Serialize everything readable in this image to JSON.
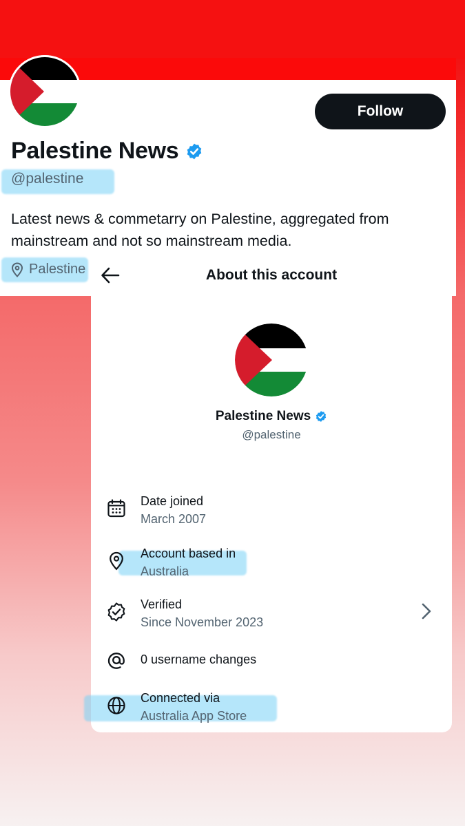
{
  "colors": {
    "accent_red": "#f51111",
    "follow_bg": "#0f1419",
    "verified_blue": "#1d9bf0",
    "highlight": "#78d2f5"
  },
  "profile": {
    "display_name": "Palestine News",
    "handle": "@palestine",
    "bio": "Latest news & commetarry on Palestine, aggregated from mainstream and not so mainstream media.",
    "location": "Palestine",
    "follow_label": "Follow"
  },
  "about": {
    "title": "About this account",
    "name": "Palestine News",
    "handle": "@palestine",
    "rows": [
      {
        "icon": "calendar-icon",
        "title": "Date joined",
        "value": "March 2007"
      },
      {
        "icon": "location-pin-icon",
        "title": "Account based in",
        "value": "Australia"
      },
      {
        "icon": "verified-icon",
        "title": "Verified",
        "value": "Since November 2023"
      },
      {
        "icon": "at-icon",
        "title": "0 username changes",
        "value": ""
      },
      {
        "icon": "globe-icon",
        "title": "Connected via",
        "value": "Australia App Store"
      }
    ]
  }
}
